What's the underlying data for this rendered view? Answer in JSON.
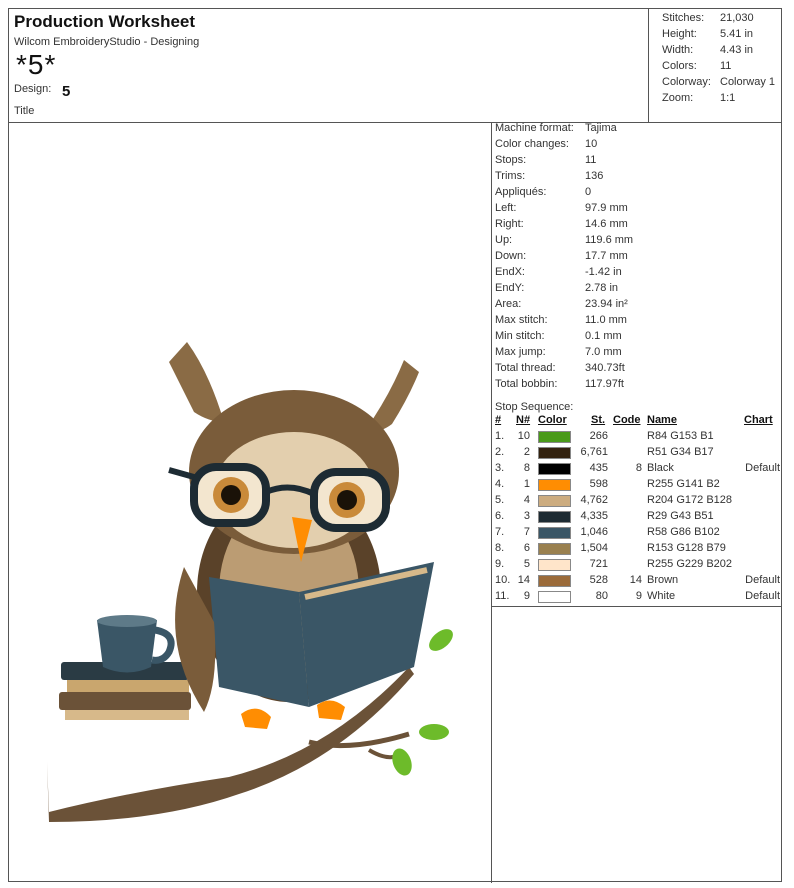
{
  "header": {
    "title": "Production Worksheet",
    "subtitle": "Wilcom EmbroideryStudio - Designing",
    "design_name": "*5*",
    "design_label": "Design:",
    "design_value": "5",
    "title_label": "Title"
  },
  "summary": [
    {
      "label": "Stitches:",
      "value": "21,030"
    },
    {
      "label": "Height:",
      "value": "5.41 in"
    },
    {
      "label": "Width:",
      "value": "4.43 in"
    },
    {
      "label": "Colors:",
      "value": "11"
    },
    {
      "label": "Colorway:",
      "value": "Colorway 1"
    },
    {
      "label": "Zoom:",
      "value": "1:1"
    }
  ],
  "details": [
    {
      "label": "Machine format:",
      "value": "Tajima"
    },
    {
      "label": "Color changes:",
      "value": "10"
    },
    {
      "label": "Stops:",
      "value": "11"
    },
    {
      "label": "Trims:",
      "value": "136"
    },
    {
      "label": "Appliqués:",
      "value": "0"
    },
    {
      "label": "Left:",
      "value": "97.9 mm"
    },
    {
      "label": "Right:",
      "value": "14.6 mm"
    },
    {
      "label": "Up:",
      "value": "119.6 mm"
    },
    {
      "label": "Down:",
      "value": "17.7 mm"
    },
    {
      "label": "EndX:",
      "value": "-1.42 in"
    },
    {
      "label": "EndY:",
      "value": "2.78 in"
    },
    {
      "label": "Area:",
      "value": "23.94 in²"
    },
    {
      "label": "Max stitch:",
      "value": "11.0 mm"
    },
    {
      "label": "Min stitch:",
      "value": "0.1 mm"
    },
    {
      "label": "Max jump:",
      "value": "7.0 mm"
    },
    {
      "label": "Total thread:",
      "value": "340.73ft"
    },
    {
      "label": "Total bobbin:",
      "value": "117.97ft"
    }
  ],
  "stop_sequence": {
    "label": "Stop Sequence:",
    "headers": {
      "idx": "#",
      "n": "N#",
      "color": "Color",
      "st": "St.",
      "code": "Code",
      "name": "Name",
      "chart": "Chart"
    },
    "rows": [
      {
        "idx": "1.",
        "n": "10",
        "color": "#4a9a1a",
        "st": "266",
        "code": "",
        "name": "R84 G153 B1",
        "chart": ""
      },
      {
        "idx": "2.",
        "n": "2",
        "color": "#33220f",
        "st": "6,761",
        "code": "",
        "name": "R51 G34 B17",
        "chart": ""
      },
      {
        "idx": "3.",
        "n": "8",
        "color": "#000000",
        "st": "435",
        "code": "8",
        "name": "Black",
        "chart": "Default"
      },
      {
        "idx": "4.",
        "n": "1",
        "color": "#ff8d02",
        "st": "598",
        "code": "",
        "name": "R255 G141 B2",
        "chart": ""
      },
      {
        "idx": "5.",
        "n": "4",
        "color": "#ccac80",
        "st": "4,762",
        "code": "",
        "name": "R204 G172 B128",
        "chart": ""
      },
      {
        "idx": "6.",
        "n": "3",
        "color": "#1d2b33",
        "st": "4,335",
        "code": "",
        "name": "R29 G43 B51",
        "chart": ""
      },
      {
        "idx": "7.",
        "n": "7",
        "color": "#3a5666",
        "st": "1,046",
        "code": "",
        "name": "R58 G86 B102",
        "chart": ""
      },
      {
        "idx": "8.",
        "n": "6",
        "color": "#99804f",
        "st": "1,504",
        "code": "",
        "name": "R153 G128 B79",
        "chart": ""
      },
      {
        "idx": "9.",
        "n": "5",
        "color": "#ffe5ca",
        "st": "721",
        "code": "",
        "name": "R255 G229 B202",
        "chart": ""
      },
      {
        "idx": "10.",
        "n": "14",
        "color": "#9b6b3a",
        "st": "528",
        "code": "14",
        "name": "Brown",
        "chart": "Default"
      },
      {
        "idx": "11.",
        "n": "9",
        "color": "#ffffff",
        "st": "80",
        "code": "9",
        "name": "White",
        "chart": "Default"
      }
    ]
  },
  "colors": {
    "border": "#555555",
    "owl_dark": "#5a4229",
    "owl_light": "#ccac80",
    "book": "#3a5666",
    "leaf": "#6dbb2a",
    "beak": "#ff8d02"
  }
}
